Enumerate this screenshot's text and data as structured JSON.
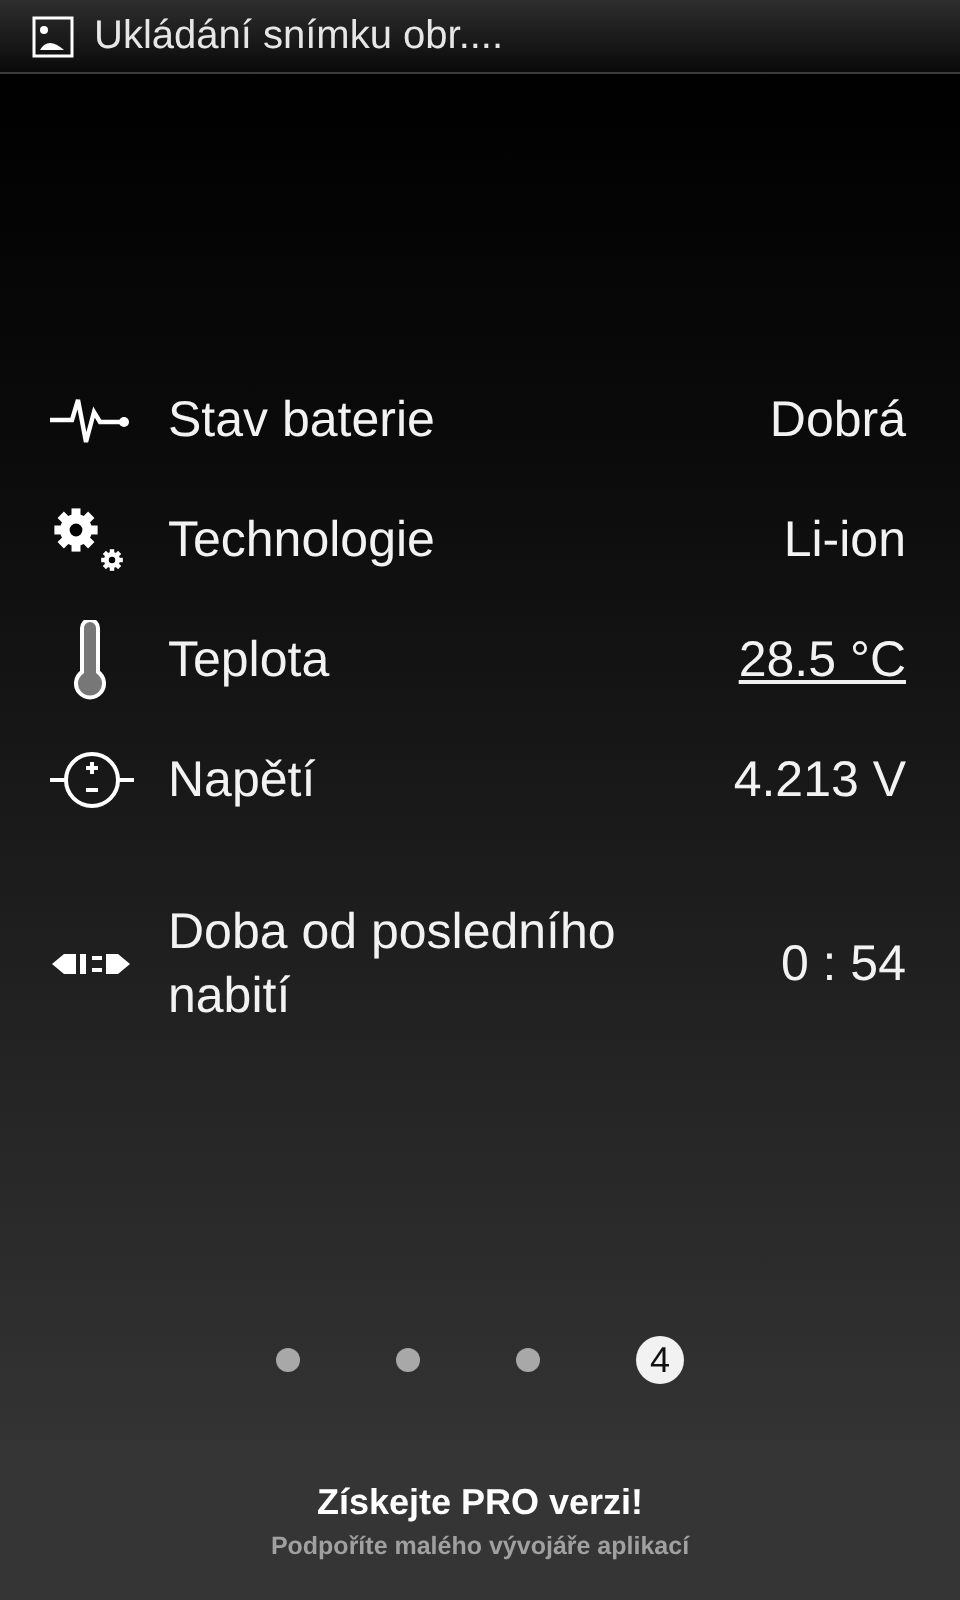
{
  "status_bar": {
    "notification": "Ukládání snímku obr...."
  },
  "rows": [
    {
      "kind": "health",
      "label": "Stav baterie",
      "value": "Dobrá",
      "link": false
    },
    {
      "kind": "technology",
      "label": "Technologie",
      "value": "Li-ion",
      "link": false
    },
    {
      "kind": "temperature",
      "label": "Teplota",
      "value": "28.5 °C",
      "link": true
    },
    {
      "kind": "voltage",
      "label": "Napětí",
      "value": "4.213 V",
      "link": false
    },
    {
      "kind": "plug",
      "label": "Doba od posledního nabití",
      "value": "0 : 54",
      "link": false
    }
  ],
  "pages": [
    {
      "selected": false
    },
    {
      "selected": false
    },
    {
      "selected": false
    },
    {
      "selected": true,
      "label": "4"
    }
  ],
  "promo": {
    "title": "Získejte PRO verzi!",
    "subtitle": "Podpoříte malého vývojáře aplikací"
  }
}
